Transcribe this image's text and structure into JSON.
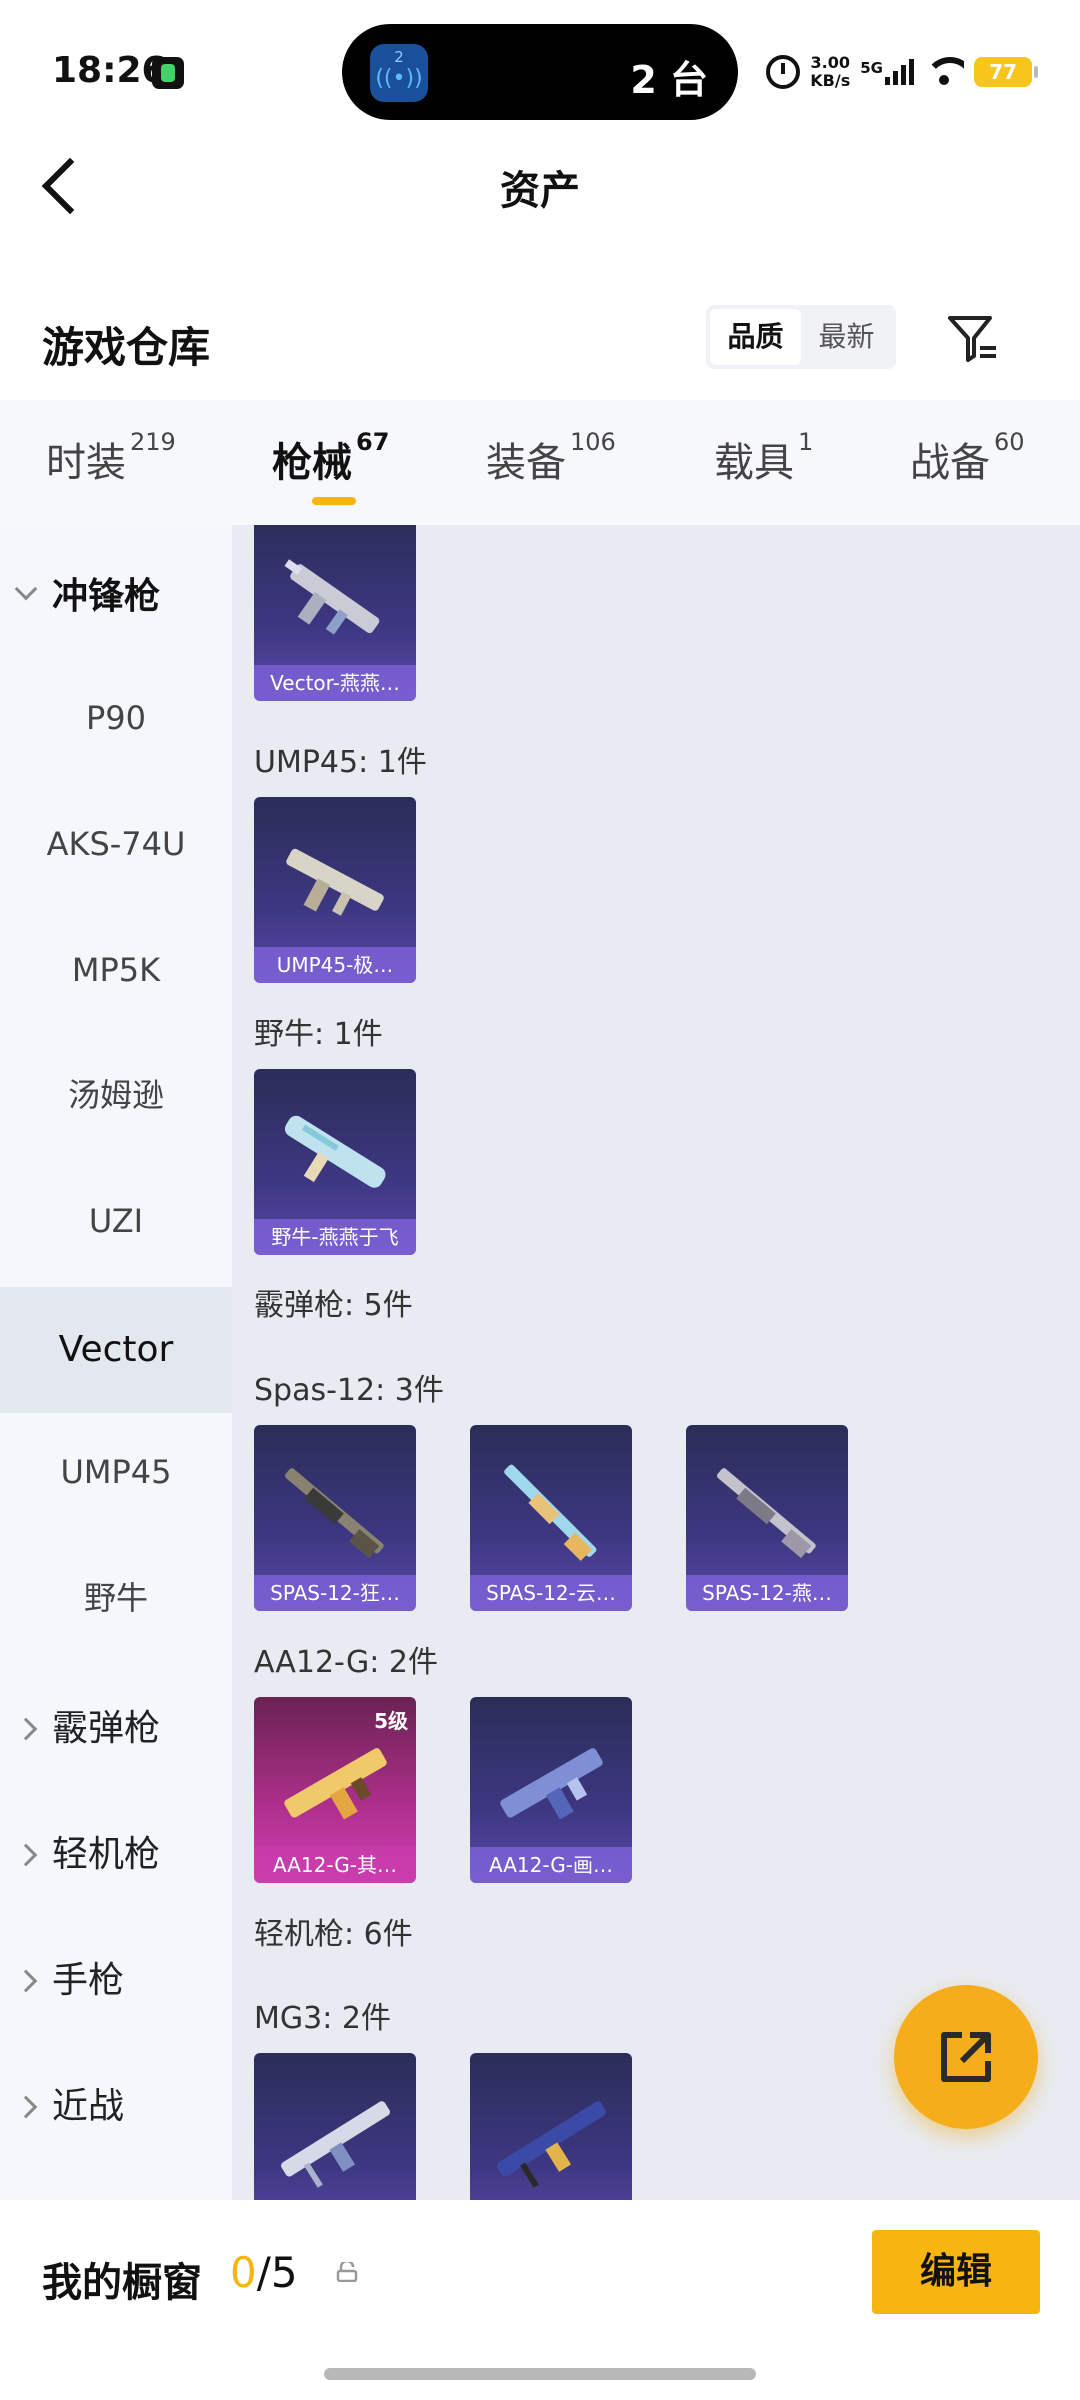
{
  "status_bar": {
    "time": "18:26",
    "island_text": "2 台",
    "island_badge": "2",
    "net_speed_value": "3.00",
    "net_speed_unit": "KB/s",
    "network": "5G",
    "battery": "77"
  },
  "header": {
    "title": "资产"
  },
  "warehouse": {
    "title": "游戏仓库",
    "sort_options": [
      "品质",
      "最新"
    ]
  },
  "tabs": [
    {
      "label": "时装",
      "count": "219"
    },
    {
      "label": "枪械",
      "count": "67"
    },
    {
      "label": "装备",
      "count": "106"
    },
    {
      "label": "载具",
      "count": "1"
    },
    {
      "label": "战备",
      "count": "60"
    }
  ],
  "sidebar": {
    "items": [
      {
        "label": "冲锋枪",
        "type": "category",
        "expanded": true
      },
      {
        "label": "P90",
        "type": "sub"
      },
      {
        "label": "AKS-74U",
        "type": "sub"
      },
      {
        "label": "MP5K",
        "type": "sub"
      },
      {
        "label": "汤姆逊",
        "type": "sub"
      },
      {
        "label": "UZI",
        "type": "sub"
      },
      {
        "label": "Vector",
        "type": "sub",
        "selected": true
      },
      {
        "label": "UMP45",
        "type": "sub"
      },
      {
        "label": "野牛",
        "type": "sub"
      },
      {
        "label": "霰弹枪",
        "type": "category"
      },
      {
        "label": "轻机枪",
        "type": "category"
      },
      {
        "label": "手枪",
        "type": "category"
      },
      {
        "label": "近战",
        "type": "category"
      }
    ]
  },
  "content": {
    "groups": [
      {
        "label": "UMP45: 1件"
      },
      {
        "label": "野牛: 1件"
      },
      {
        "label": "霰弹枪: 5件"
      },
      {
        "label": "Spas-12: 3件"
      },
      {
        "label": "AA12-G: 2件"
      },
      {
        "label": "轻机枪: 6件"
      },
      {
        "label": "MG3: 2件"
      }
    ],
    "cards": [
      {
        "label": "Vector-燕燕…",
        "icon": "smg-icon"
      },
      {
        "label": "UMP45-极…",
        "icon": "smg-icon"
      },
      {
        "label": "野牛-燕燕于飞",
        "icon": "smg-icon"
      },
      {
        "label": "SPAS-12-狂…",
        "icon": "shotgun-icon"
      },
      {
        "label": "SPAS-12-云…",
        "icon": "shotgun-icon"
      },
      {
        "label": "SPAS-12-燕…",
        "icon": "shotgun-icon"
      },
      {
        "label": "AA12-G-其…",
        "icon": "shotgun-icon",
        "badge": "5级",
        "quality_color": "#c43aa8"
      },
      {
        "label": "AA12-G-画…",
        "icon": "shotgun-icon"
      },
      {
        "label": "",
        "icon": "lmg-icon"
      },
      {
        "label": "",
        "icon": "lmg-icon"
      }
    ]
  },
  "bottom_bar": {
    "window_label": "我的橱窗",
    "window_current": "0",
    "window_total": "/5",
    "edit_label": "编辑"
  },
  "colors": {
    "accent": "#f6b510",
    "card_purple": "#3d3782",
    "card_pink": "#b02f8d"
  }
}
